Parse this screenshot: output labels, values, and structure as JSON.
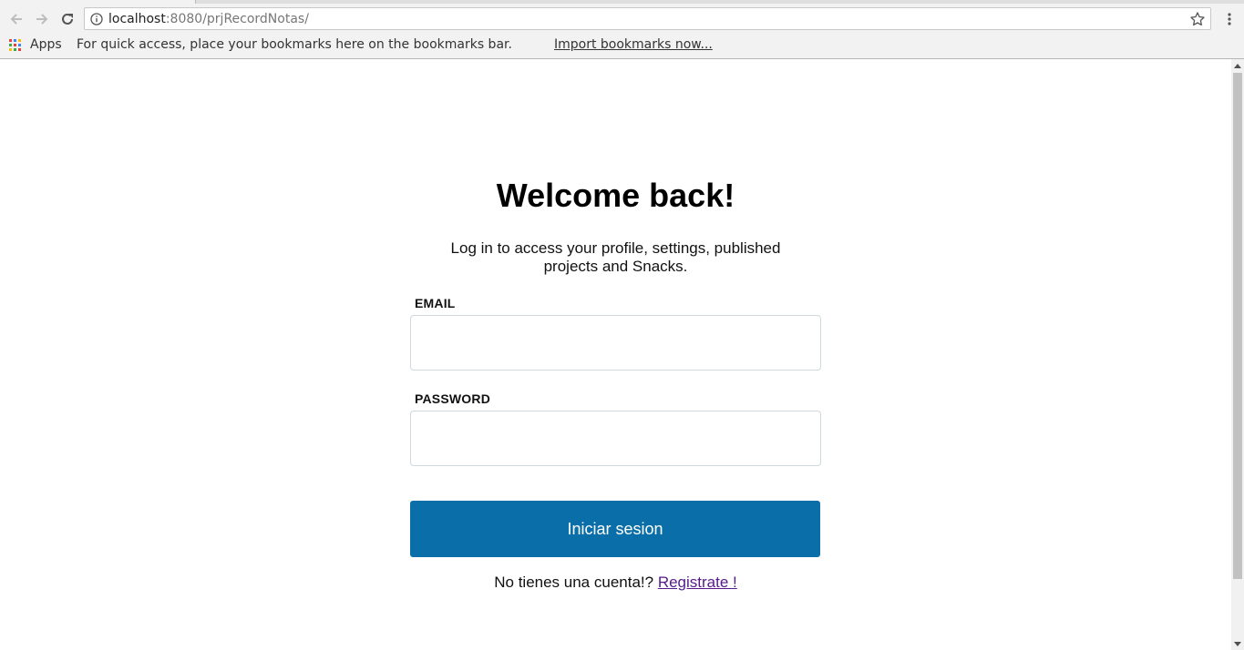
{
  "browser": {
    "url_host": "localhost",
    "url_rest": ":8080/prjRecordNotas/",
    "bookmarks_bar": {
      "apps_label": "Apps",
      "hint": "For quick access, place your bookmarks here on the bookmarks bar.",
      "import_link": "Import bookmarks now..."
    }
  },
  "login": {
    "title": "Welcome back!",
    "subtitle": "Log in to access your profile, settings, published projects and Snacks.",
    "email_label": "EMAIL",
    "email_value": "",
    "password_label": "PASSWORD",
    "password_value": "",
    "submit_label": "Iniciar sesion",
    "register_prompt": "No tienes una cuenta!?",
    "register_link": "Registrate !"
  },
  "colors": {
    "primary_button": "#0a6fa8",
    "visited_link": "#551a8b"
  },
  "icons": [
    "back-arrow-icon",
    "forward-arrow-icon",
    "reload-icon",
    "info-icon",
    "star-icon",
    "menu-dots-icon",
    "apps-grid-icon"
  ]
}
